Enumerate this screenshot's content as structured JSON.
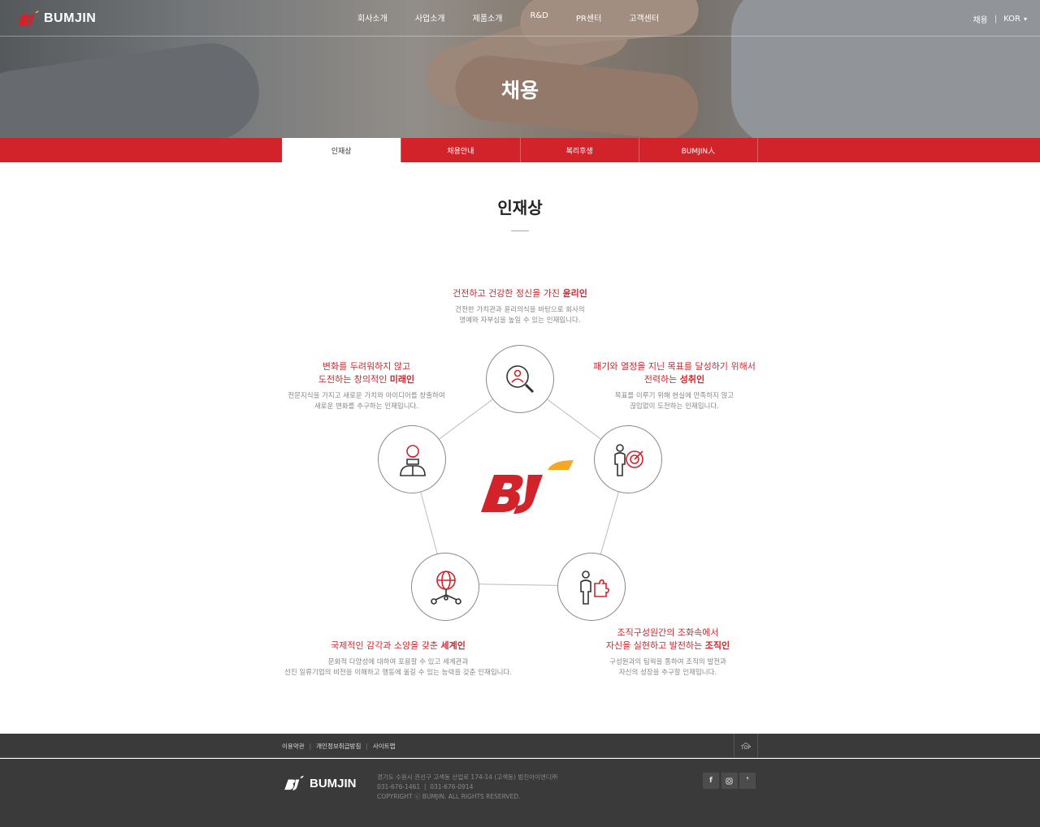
{
  "header": {
    "logo_text": "BUMJIN",
    "nav": [
      "회사소개",
      "사업소개",
      "제품소개",
      "R&D",
      "PR센터",
      "고객센터"
    ],
    "util": {
      "recruit": "채용",
      "separator": "|",
      "lang": "KOR"
    }
  },
  "hero": {
    "title": "채용"
  },
  "subnav": {
    "tabs": [
      "인재상",
      "채용안내",
      "복리후생",
      "BUMJIN人"
    ],
    "active_index": 0
  },
  "section": {
    "title": "인재상"
  },
  "traits": {
    "top": {
      "head_prefix": "건전하고 건강한 정신을 가진 ",
      "head_bold": "윤리인",
      "desc_line1": "건전한 가치관과 윤리의식을 바탕으로 회사의",
      "desc_line2": "명예와 자부심을 높일 수 있는 인재입니다.",
      "icon": "search-person-icon"
    },
    "left": {
      "head_line1": "변화를 두려워하지 않고",
      "head_prefix": "도전하는 창의적인 ",
      "head_bold": "미래인",
      "desc_line1": "전문지식을 가지고 새로운 가치와 아이디어를 창출하여",
      "desc_line2": "새로운 변화를 추구하는 인재입니다.",
      "icon": "lightbulb-person-icon"
    },
    "right": {
      "head_line1": "패기와 열정을 지닌 목표를 달성하기 위해서",
      "head_prefix": "전력하는 ",
      "head_bold": "성취인",
      "desc_line1": "목표를 이루기 위해 현실에 만족하지 않고",
      "desc_line2": "끊임없이 도전하는 인재입니다.",
      "icon": "target-person-icon"
    },
    "bottom_left": {
      "head_prefix": "국제적인 감각과 소양을 갖춘 ",
      "head_bold": "세계인",
      "desc_line1": "문화적 다양성에 대하여 포용할 수 있고 세계관과",
      "desc_line2": "선진 일류기업의 비전을 이해하고 행동에 옮길 수 있는 능력을 갖춘 인재입니다.",
      "icon": "globe-network-icon"
    },
    "bottom_right": {
      "head_line1": "조직구성원간의 조화속에서",
      "head_prefix": "자신을 실현하고 발전하는 ",
      "head_bold": "조직인",
      "desc_line1": "구성원과의 팀웍을 통하여 조직의 발전과",
      "desc_line2": "자신의 성장을 추구할 인재입니다.",
      "icon": "person-puzzle-icon"
    }
  },
  "footer": {
    "links": [
      "이용약관",
      "개인정보취급방침",
      "사이트맵"
    ],
    "top_label": "TOP",
    "logo_text": "BUMJIN",
    "address": "경기도 수원시 권선구 고색동 산업로 174-14 (고색동) 범진아이앤디㈜",
    "tel": "031-676-1461",
    "fax": "031-676-0914",
    "copyright": "COPYRIGHT ⓒ BUMJIN. ALL RIGHTS RESERVED.",
    "social": [
      "facebook-icon",
      "instagram-icon",
      "blog-icon"
    ]
  },
  "colors": {
    "brand_red": "#d3232a",
    "brand_orange": "#f5a623",
    "footer_bg": "#3a3a3a"
  }
}
